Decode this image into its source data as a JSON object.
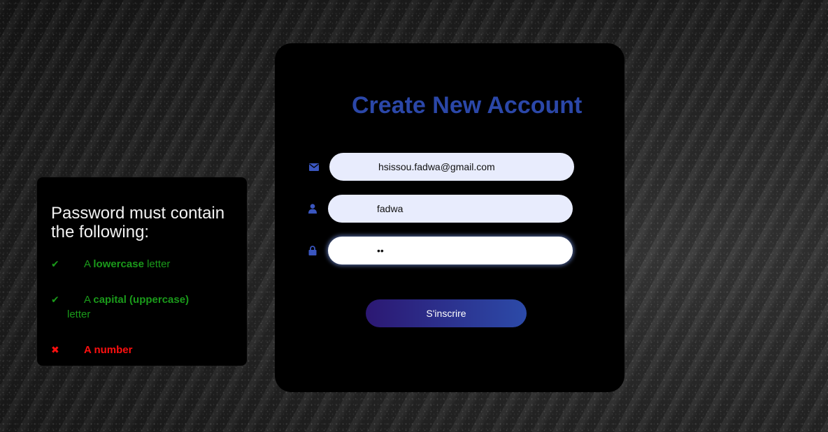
{
  "requirements": {
    "title": "Password must contain the following:",
    "items": [
      {
        "status": "valid",
        "mark": "✔",
        "prefix": "A",
        "bold": "lowercase",
        "suffix": "letter"
      },
      {
        "status": "valid",
        "mark": "✔",
        "prefix": "A",
        "bold": "capital (uppercase)",
        "suffix": "letter"
      },
      {
        "status": "invalid",
        "mark": "✖",
        "prefix": "A",
        "bold": "number",
        "suffix": ""
      }
    ]
  },
  "form": {
    "title": "Create New Account",
    "email": {
      "icon": "envelope-icon",
      "value": "hsissou.fadwa@gmail.com"
    },
    "username": {
      "icon": "user-icon",
      "value": "fadwa"
    },
    "password": {
      "icon": "lock-icon",
      "value": "••"
    },
    "submit_label": "S'inscrire"
  },
  "colors": {
    "accent": "#2b47a8",
    "valid": "#1a9a1a",
    "invalid": "#ff1010",
    "input_bg": "#e8ecfd"
  }
}
